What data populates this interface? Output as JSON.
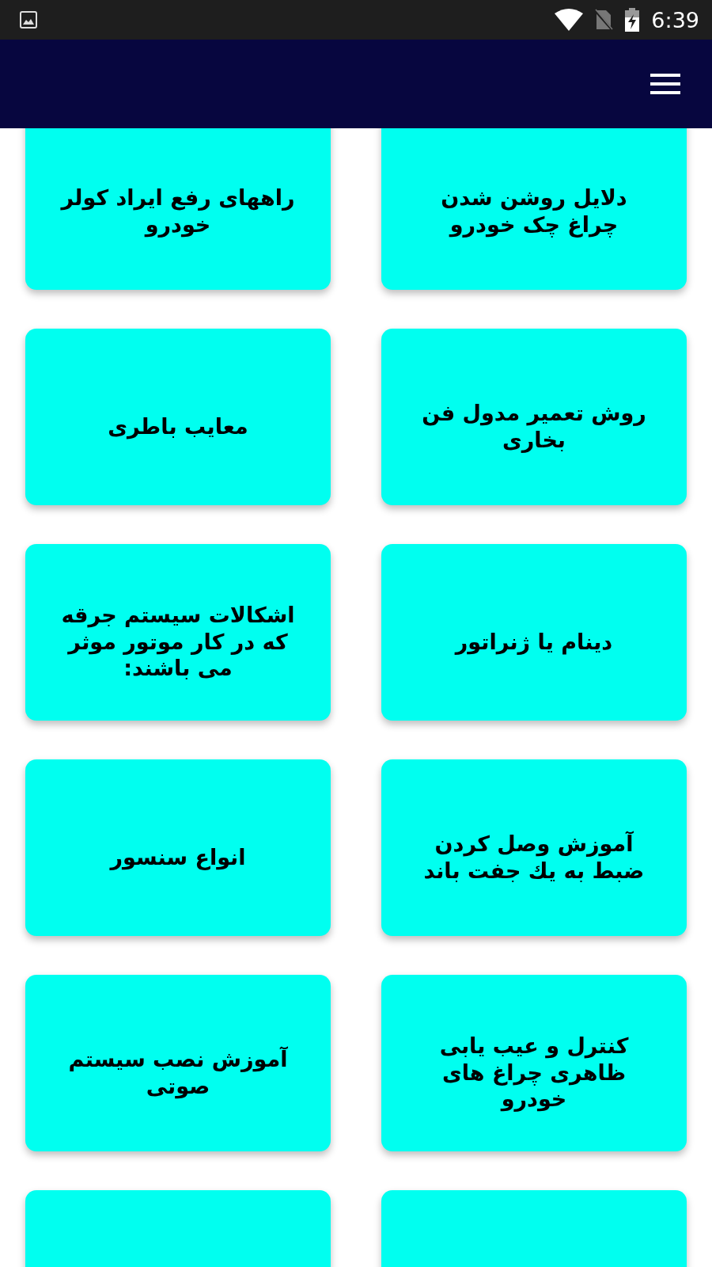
{
  "status_bar": {
    "time": "6:39"
  },
  "rows": [
    {
      "cards": [
        {
          "kind": "topic",
          "title": "دلایل روشن شدن چراغ چک خودرو"
        },
        {
          "kind": "topic",
          "title": "راههای رفع ایراد کولر خودرو"
        }
      ]
    },
    {
      "cards": [
        {
          "kind": "topic",
          "title": "روش تعمیر مدول فن بخاری"
        },
        {
          "kind": "topic",
          "title": "معایب باطری"
        }
      ]
    },
    {
      "cards": [
        {
          "kind": "topic",
          "title": "دینام یا ژنراتور"
        },
        {
          "kind": "topic",
          "title": "اشکالات سیستم جرقه که در کار موتور موثر می باشند:"
        }
      ]
    },
    {
      "cards": [
        {
          "kind": "topic",
          "title": "آموزش وصل کردن ضبط به یك جفت باند"
        },
        {
          "kind": "topic",
          "title": "انواع سنسور"
        }
      ]
    },
    {
      "cards": [
        {
          "kind": "topic",
          "title": "کنترل و عیب یابی ظاهری چراغ های خودرو"
        },
        {
          "kind": "topic",
          "title": "آموزش نصب سیستم صوتی"
        }
      ]
    },
    {
      "cards": [
        {
          "kind": "cut"
        },
        {
          "kind": "cut"
        }
      ]
    }
  ]
}
